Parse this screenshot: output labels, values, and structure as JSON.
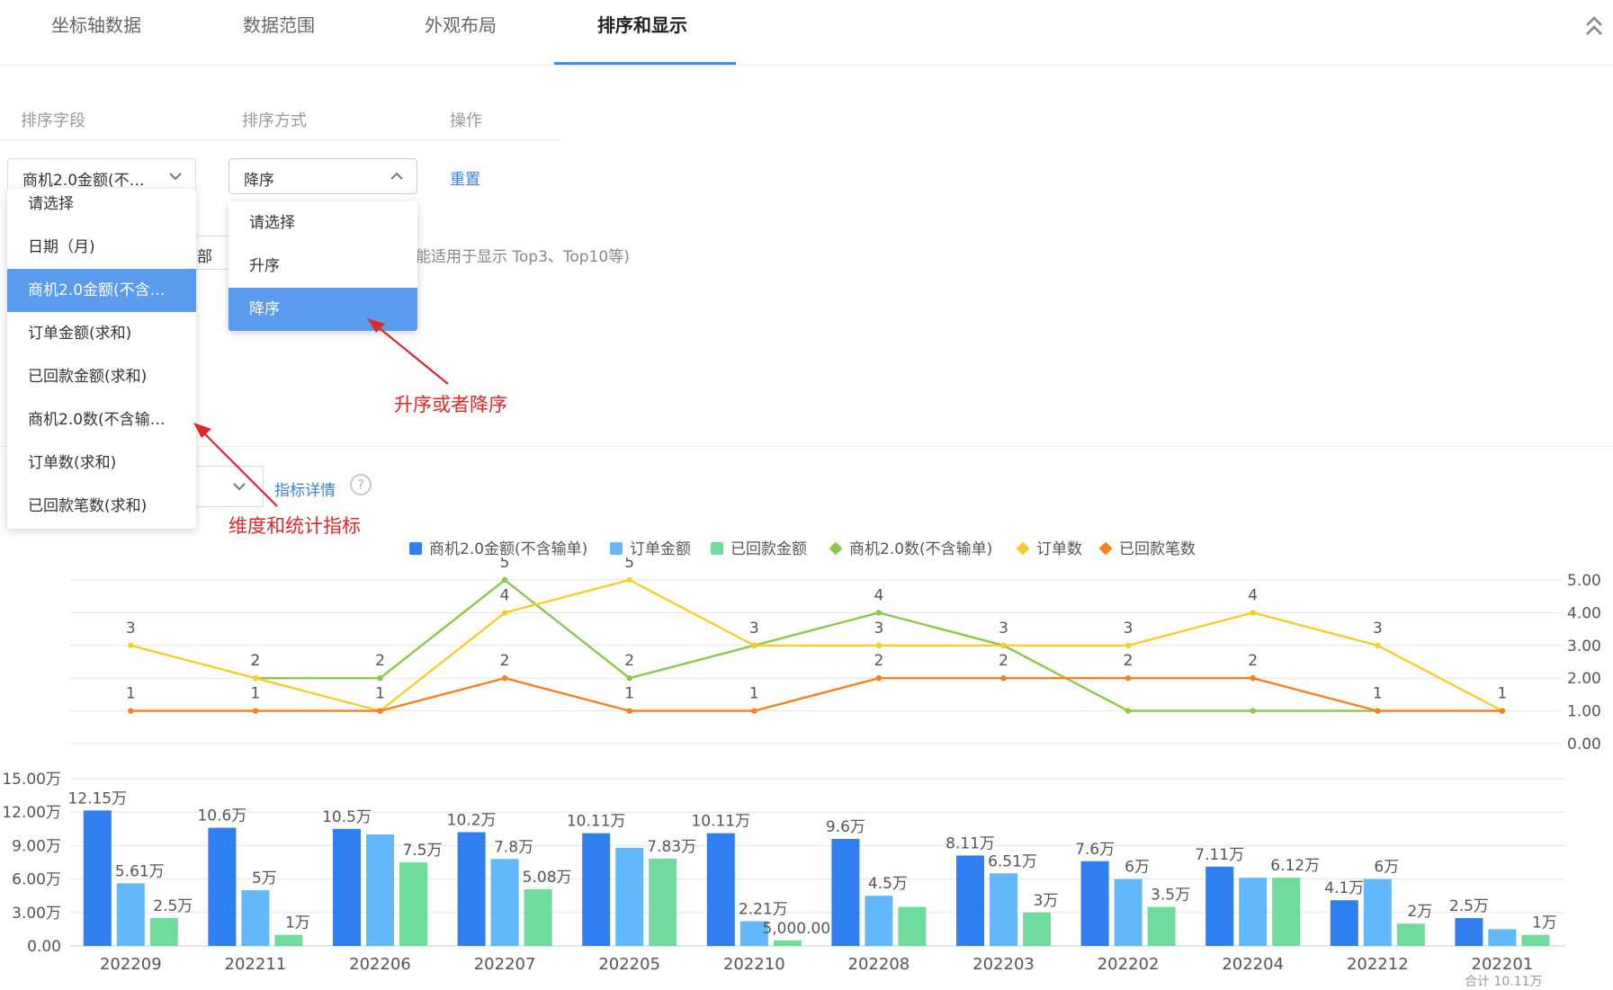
{
  "tabs": [
    "坐标轴数据",
    "数据范围",
    "外观布局",
    "排序和显示"
  ],
  "active_tab": 3,
  "sort": {
    "headers": {
      "field": "排序字段",
      "method": "排序方式",
      "action": "操作"
    },
    "field_value": "商机2.0金额(不…",
    "method_value": "降序",
    "reset": "重置"
  },
  "field_dropdown": {
    "items": [
      "请选择",
      "日期（月)",
      "商机2.0金额(不含…",
      "订单金额(求和)",
      "已回款金额(求和)",
      "商机2.0数(不含输…",
      "订单数(求和)",
      "已回款笔数(求和)"
    ],
    "selected_index": 2
  },
  "method_dropdown": {
    "items": [
      "请选择",
      "升序",
      "降序"
    ],
    "selected_index": 2
  },
  "partial": {
    "behind_text_1": "部",
    "behind_text_2": "能适用于显示 Top3、Top10等)",
    "indicator_link": "指标详情",
    "help_icon": "?"
  },
  "annotations": {
    "order": "升序或者降序",
    "dims": "维度和统计指标"
  },
  "colors": {
    "accent": "#3d8af7",
    "series": [
      "#2f7ff0",
      "#62b8fb",
      "#6fdc9e",
      "#8cc84b",
      "#f7cd2e",
      "#f6801e"
    ],
    "annotation": "#e0262a"
  },
  "chart_data": {
    "type": "bar",
    "categories": [
      "202209",
      "202211",
      "202206",
      "202207",
      "202205",
      "202210",
      "202208",
      "202203",
      "202202",
      "202204",
      "202212",
      "202201"
    ],
    "legend": [
      "商机2.0金额(不含输单)",
      "订单金额",
      "已回款金额",
      "商机2.0数(不含输单)",
      "订单数",
      "已回款笔数"
    ],
    "bar_series": [
      {
        "name": "商机2.0金额(不含输单)",
        "values": [
          12.15,
          10.6,
          10.5,
          10.2,
          10.11,
          10.11,
          9.6,
          8.11,
          7.6,
          7.11,
          4.1,
          2.5
        ],
        "labels": [
          "12.15万",
          "10.6万",
          "10.5万",
          "10.2万",
          "10.11万",
          "10.11万",
          "9.6万",
          "8.11万",
          "7.6万",
          "7.11万",
          "4.1万",
          "2.5万"
        ]
      },
      {
        "name": "订单金额",
        "values": [
          5.61,
          5,
          10,
          7.8,
          8.8,
          2.21,
          4.5,
          6.51,
          6,
          6.12,
          6,
          1.5
        ],
        "labels": [
          "5.61万",
          "5万",
          "",
          "7.8万",
          "",
          "2.21万",
          "4.5万",
          "6.51万",
          "6万",
          "",
          "6万",
          ""
        ]
      },
      {
        "name": "已回款金额",
        "values": [
          2.5,
          1,
          7.5,
          5.08,
          7.83,
          0.5,
          3.5,
          3,
          3.5,
          6.12,
          2,
          1
        ],
        "labels": [
          "2.5万",
          "1万",
          "7.5万",
          "5.08万",
          "7.83万",
          "5,000.00",
          "",
          "3万",
          "3.5万",
          "6.12万",
          "2万",
          "1万"
        ]
      }
    ],
    "line_series": [
      {
        "name": "商机2.0数(不含输单)",
        "values": [
          null,
          2,
          2,
          5,
          2,
          3,
          4,
          3,
          1,
          1,
          1,
          null
        ],
        "labels": [
          "",
          "",
          "",
          "5",
          "",
          "",
          "4",
          "",
          "",
          "",
          "",
          ""
        ]
      },
      {
        "name": "订单数",
        "values": [
          3,
          2,
          1,
          4,
          5,
          3,
          3,
          3,
          3,
          4,
          3,
          1
        ],
        "labels": [
          "3",
          "2",
          "",
          "4",
          "5",
          "3",
          "3",
          "3",
          "3",
          "4",
          "3",
          ""
        ]
      },
      {
        "name": "已回款笔数",
        "values": [
          1,
          1,
          1,
          2,
          1,
          1,
          2,
          2,
          2,
          2,
          1,
          1
        ],
        "labels": [
          "1",
          "1",
          "1",
          "2",
          "1",
          "1",
          "2",
          "2",
          "2",
          "2",
          "1",
          "1"
        ]
      }
    ],
    "extra_labels": [
      "2",
      "2",
      "2",
      "2"
    ],
    "bar_yticks": [
      "0.00",
      "3.00万",
      "6.00万",
      "9.00万",
      "12.00万",
      "15.00万"
    ],
    "bar_ylim": [
      0,
      15
    ],
    "line_yticks": [
      "0.00",
      "1.00",
      "2.00",
      "3.00",
      "4.00",
      "5.00"
    ],
    "line_ylim": [
      0,
      5
    ],
    "footer_text": "合计 10.11万"
  }
}
